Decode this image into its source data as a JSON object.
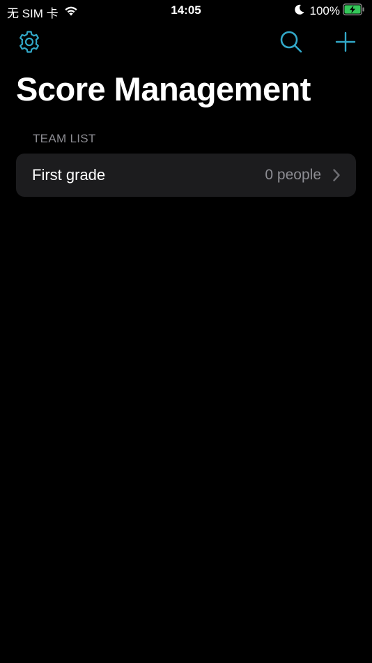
{
  "status_bar": {
    "carrier": "无 SIM 卡",
    "time": "14:05",
    "battery_percent": "100%"
  },
  "nav": {
    "settings_icon": "gear-icon",
    "search_icon": "search-icon",
    "add_icon": "plus-icon",
    "accent_color": "#32a8c8"
  },
  "header": {
    "title": "Score Management"
  },
  "team_list": {
    "section_title": "TEAM LIST",
    "items": [
      {
        "label": "First grade",
        "detail": "0 people"
      }
    ]
  }
}
